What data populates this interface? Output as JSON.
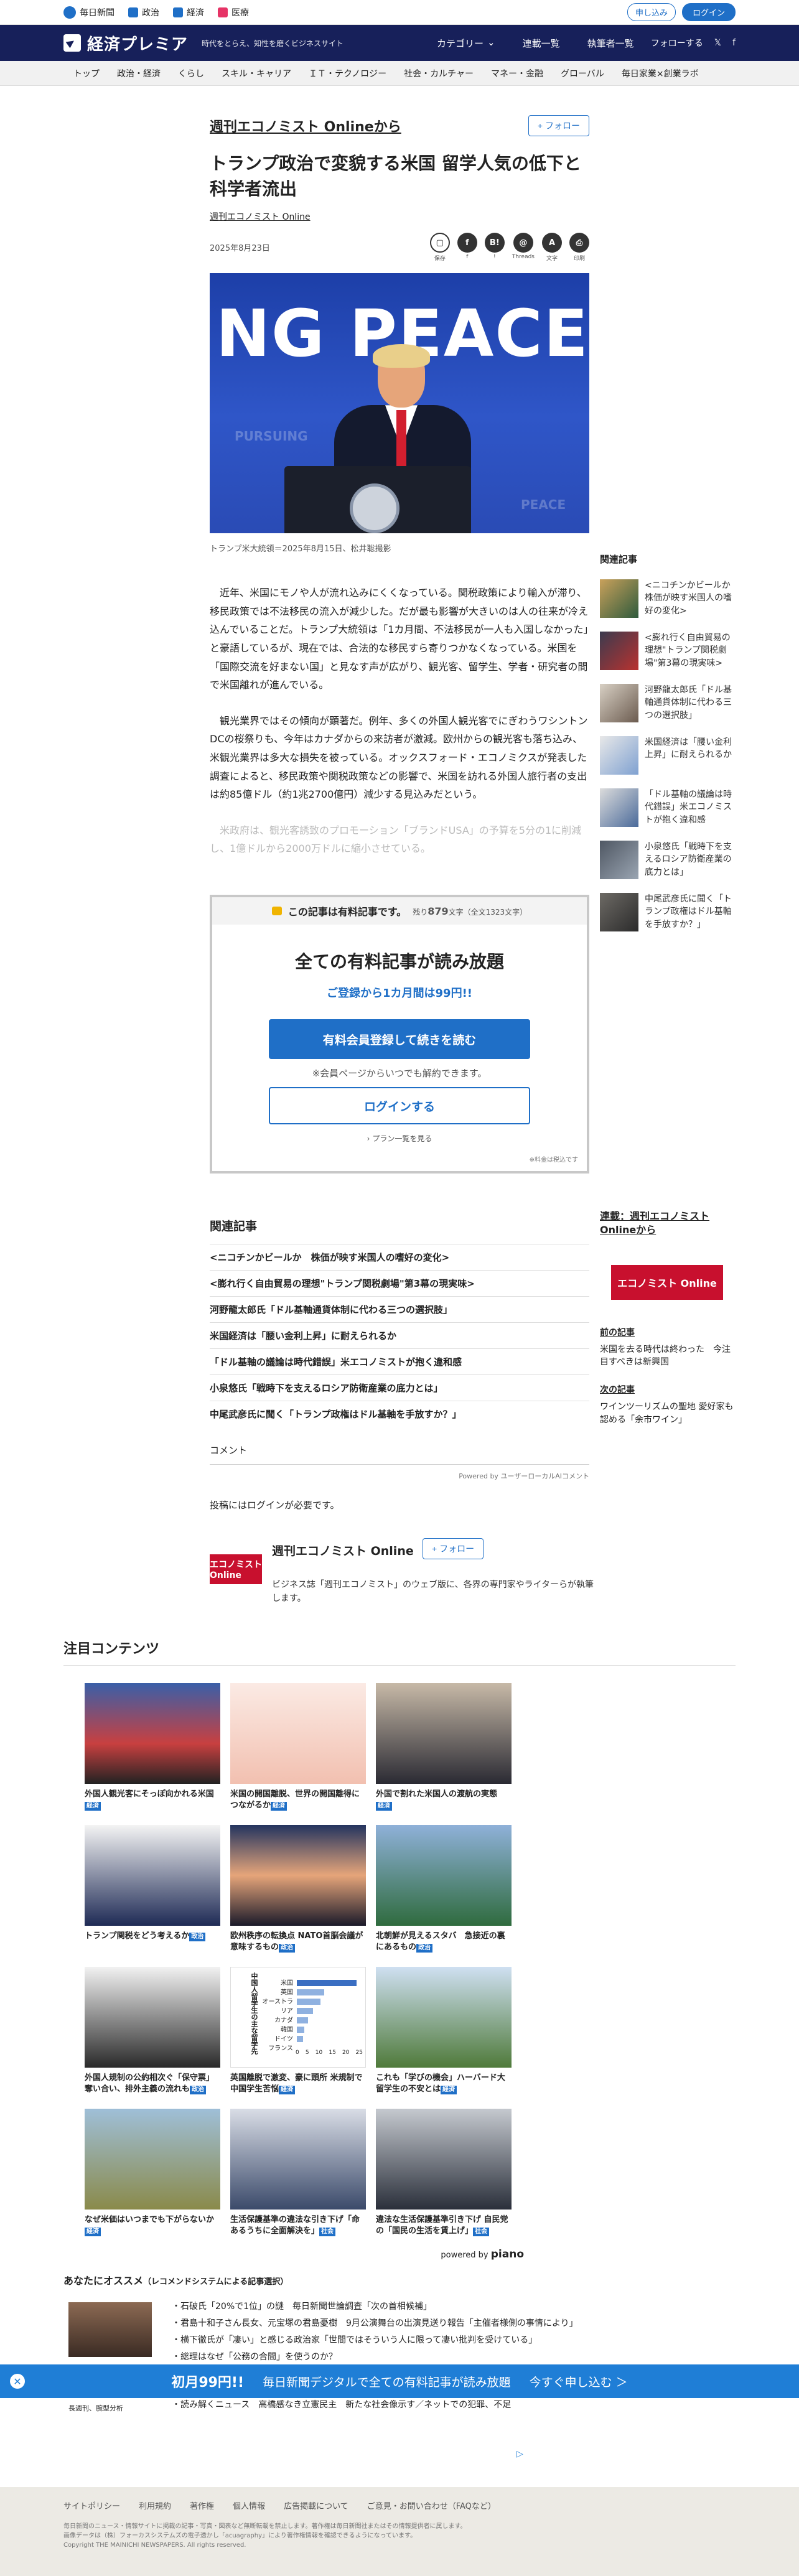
{
  "topbar": {
    "sites": [
      {
        "label": "毎日新聞",
        "icon": "mainichi-logo-icon"
      },
      {
        "label": "政治",
        "icon": "politics-icon"
      },
      {
        "label": "経済",
        "icon": "economy-icon"
      },
      {
        "label": "医療",
        "icon": "medical-icon"
      }
    ],
    "apply_label": "申し込み",
    "login_label": "ログイン"
  },
  "header": {
    "brand": "経済プレミア",
    "tagline": "時代をとらえ、知性を磨くビジネスサイト",
    "menus": [
      "カテゴリー",
      "連載一覧",
      "執筆者一覧"
    ],
    "follow_label": "フォローする",
    "colors": {
      "navy": "#17205a",
      "accent": "#1f6fc7"
    }
  },
  "catnav": [
    "トップ",
    "政治・経済",
    "くらし",
    "スキル・キャリア",
    "ＩＴ・テクノロジー",
    "社会・カルチャー",
    "マネー・金融",
    "グローバル",
    "毎日家業×創業ラボ"
  ],
  "article": {
    "source": "週刊エコノミスト Onlineから",
    "follow_label": "+ フォロー",
    "title": "トランプ政治で変貌する米国 留学人気の低下と科学者流出",
    "author": "週刊エコノミスト Online",
    "date": "2025年8月23日",
    "share": [
      {
        "label": "保存",
        "glyph": "▢"
      },
      {
        "label": "f",
        "glyph": "f"
      },
      {
        "label": "!",
        "glyph": "B!"
      },
      {
        "label": "Threads",
        "glyph": "@"
      },
      {
        "label": "文字",
        "glyph": "A"
      },
      {
        "label": "印刷",
        "glyph": "⎙"
      }
    ],
    "photo_text": "NG PEACE",
    "photo_bg_1": "PURSUING",
    "photo_bg_2": "PEACE",
    "caption": "トランプ米大統領＝2025年8月15日、松井聡撮影",
    "paragraphs": [
      "近年、米国にモノや人が流れ込みにくくなっている。関税政策により輸入が滞り、移民政策では不法移民の流入が減少した。だが最も影響が大きいのは人の往来が冷え込んでいることだ。トランプ大統領は「1カ月間、不法移民が一人も入国しなかった」と豪語しているが、現在では、合法的な移民すら寄りつかなくなっている。米国を「国際交流を好まない国」と見なす声が広がり、観光客、留学生、学者・研究者の間で米国離れが進んでいる。",
      "観光業界ではその傾向が顕著だ。例年、多くの外国人観光客でにぎわうワシントンDCの桜祭りも、今年はカナダからの来訪者が激減。欧州からの観光客も落ち込み、米観光業界は多大な損失を被っている。オックスフォード・エコノミクスが発表した調査によると、移民政策や関税政策などの影響で、米国を訪れる外国人旅行者の支出は約85億ドル（約1兆2700億円）減少する見込みだという。",
      "米政府は、観光客誘致のプロモーション「ブランドUSA」の予算を5分の1に削減し、1億ドルから2000万ドルに縮小させている。"
    ]
  },
  "paywall": {
    "head": "この記事は有料記事です。",
    "rest_prefix": "残り",
    "rest_count": "879",
    "rest_suffix": "文字（全文1323文字）",
    "title": "全ての有料記事が読み放題",
    "offer": "ご登録から1カ月間は99円!!",
    "register_label": "有料会員登録して続きを読む",
    "note": "※会員ページからいつでも解約できます。",
    "login_label": "ログインする",
    "plan_label": "プラン一覧を見る",
    "tax": "※料金は税込です"
  },
  "sidebar": {
    "title": "関連記事",
    "items": [
      "<ニコチンかビールか　株価が映す米国人の嗜好の変化>",
      "<膨れ行く自由貿易の理想\"トランプ関税劇場\"第3幕の現実味>",
      "河野龍太郎氏「ドル基軸通貨体制に代わる三つの選択肢」",
      "米国経済は「腰い金利上昇」に耐えられるか",
      "「ドル基軸の議論は時代錯誤」米エコノミストが抱く違和感",
      "小泉悠氏「戦時下を支えるロシア防衛産業の底力とは」",
      "中尾武彦氏に聞く「トランプ政権はドル基軸を手放すか？」"
    ],
    "serial_title": "連載：週刊エコノミスト Onlineから",
    "logo_text": "エコノミスト Online",
    "prev_label": "前の記事",
    "prev_text": "米国を去る時代は終わった　今注目すべきは新興国",
    "next_label": "次の記事",
    "next_text": "ワインツーリズムの聖地 愛好家も認める「余市ワイン」"
  },
  "related": {
    "title": "関連記事",
    "items": [
      "<ニコチンかビールか　株価が映す米国人の嗜好の変化>",
      "<膨れ行く自由貿易の理想\"トランプ関税劇場\"第3幕の現実味>",
      "河野龍太郎氏「ドル基軸通貨体制に代わる三つの選択肢」",
      "米国経済は「腰い金利上昇」に耐えられるか",
      "「ドル基軸の議論は時代錯誤」米エコノミストが抱く違和感",
      "小泉悠氏「戦時下を支えるロシア防衛産業の底力とは」",
      "中尾武彦氏に聞く「トランプ政権はドル基軸を手放すか？」"
    ]
  },
  "comments": {
    "title": "コメント",
    "powered": "Powered by ユーザーローカルAIコメント",
    "need_login": "投稿にはログインが必要です。"
  },
  "profile": {
    "name": "週刊エコノミスト Online",
    "follow_label": "+ フォロー",
    "logo_text": "エコノミスト Online",
    "desc": "ビジネス誌「週刊エコノミスト」のウェブ版に、各界の専門家やライターらが執筆します。"
  },
  "featured": {
    "title": "注目コンテンツ",
    "cards": [
      {
        "caption": "外国人観光客にそっぽ向かれる米国",
        "tag": "経済"
      },
      {
        "caption": "米国の開国離脱、世界の開国離得につながるか",
        "tag": "経済"
      },
      {
        "caption": "外国で割れた米国人の渡航の実態",
        "tag": "経済"
      },
      {
        "caption": "トランプ関税をどう考えるか",
        "tag": "政治"
      },
      {
        "caption": "欧州秩序の転換点 NATO首脳会議が意味するもの",
        "tag": "政治"
      },
      {
        "caption": "北朝鮮が見えるスタバ　急接近の裏にあるもの",
        "tag": "政治"
      },
      {
        "caption": "外国人規制の公約相次ぐ「保守票」奪い合い、排外主義の流れも",
        "tag": "政治"
      },
      {
        "caption": "英国離脱で激変、豪に頭所 米規制で中国学生苦悩",
        "tag": "経済"
      },
      {
        "caption": "これも「学びの機会」ハーバード大留学生の不安とは",
        "tag": "経済"
      },
      {
        "caption": "なぜ米価はいつまでも下がらないか",
        "tag": "経済"
      },
      {
        "caption": "生活保護基準の違法な引き下げ「命あるうちに全面解決を」",
        "tag": "社会"
      },
      {
        "caption": "違法な生活保護基準引き下げ 自民党の「国民の生活を賃上げ」",
        "tag": "社会"
      }
    ],
    "chart_rows": [
      "米国",
      "英国",
      "オーストラリア",
      "カナダ",
      "韓国",
      "ドイツ",
      "フランス"
    ],
    "chart_ticks": [
      "0",
      "5",
      "10",
      "15",
      "20",
      "25"
    ],
    "chart_title": "中国人留学生の主な留学先",
    "powered": "powered by",
    "piano": "piano"
  },
  "reco": {
    "title": "あなたにオススメ",
    "subtitle": "（レコメンドシステムによる記事選択）",
    "items": [
      "石破氏「20%で1位」の謎　毎日新聞世論調査「次の首相候補」",
      "君島十和子さん長女、元宝塚の君島憂樹　9月公演舞台の出演見送り報告「主催者様側の事情により」",
      "横下徹氏が「凄い」と感じる政治家「世間ではそういう人に限って凄い批判を受けている」",
      "総理はなぜ「公務の合間」を使うのか？"
    ],
    "tail_items": [
      "読み解くニュース　高橋感なき立憲民主　新たな社会像示す／ネットでの犯罪、不足"
    ],
    "tail_photo_caption": "長週刊、腕型分析"
  },
  "banner": {
    "offer": "初月99円!!",
    "text": "毎日新聞デジタルで全ての有料記事が読み放題",
    "cta": "今すぐ申し込む ＞"
  },
  "footer": {
    "links": [
      "サイトポリシー",
      "利用規約",
      "著作権",
      "個人情報",
      "広告掲載について",
      "ご意見・お問い合わせ（FAQなど）"
    ],
    "fine1": "毎日新聞のニュース・情報サイトに掲載の記事・写真・図表など無断転載を禁止します。著作権は毎日新聞社またはその情報提供者に属します。",
    "fine2": "画像データは（株）フォーカスシステムズの電子透かし「acuagraphy」により著作権情報を確認できるようになっています。",
    "copyright": "Copyright THE MAINICHI NEWSPAPERS. All rights reserved."
  }
}
